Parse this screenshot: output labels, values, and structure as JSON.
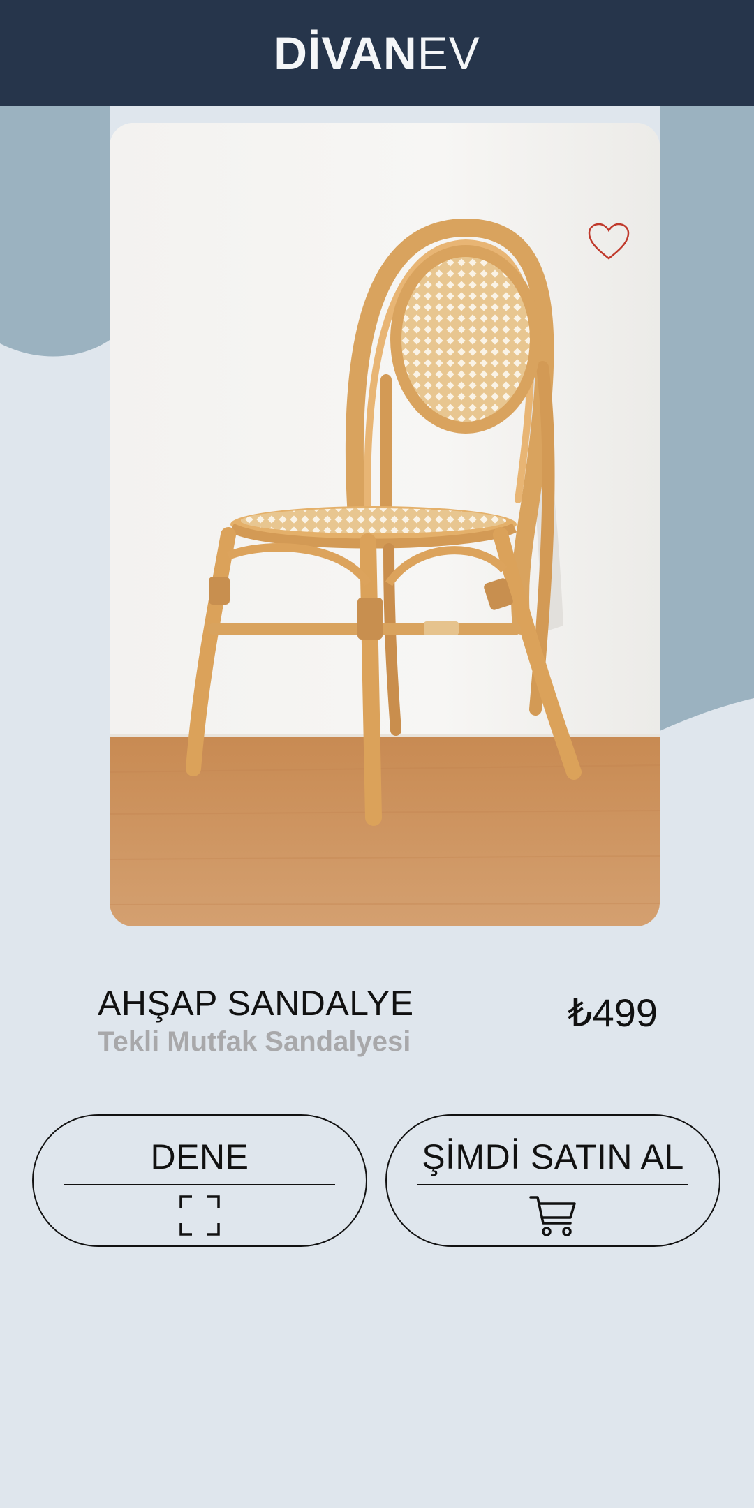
{
  "header": {
    "logo_bold": "DİVAN",
    "logo_light": "EV",
    "background": "#26354b"
  },
  "product": {
    "title": "AHŞAP SANDALYE",
    "subtitle": "Tekli Mutfak Sandalyesi",
    "price": "₺499",
    "image_icon": "rattan-chair-photo",
    "favorite_icon": "heart-outline-icon"
  },
  "actions": {
    "try_label": "DENE",
    "try_icon": "expand-frame-icon",
    "buy_label": "ŞİMDİ SATIN AL",
    "buy_icon": "shopping-cart-icon"
  },
  "colors": {
    "page_background": "#dfe6ed",
    "wave_accent": "#9bb2c0",
    "heart": "#c0392b",
    "subtitle": "#a8a8aa"
  }
}
